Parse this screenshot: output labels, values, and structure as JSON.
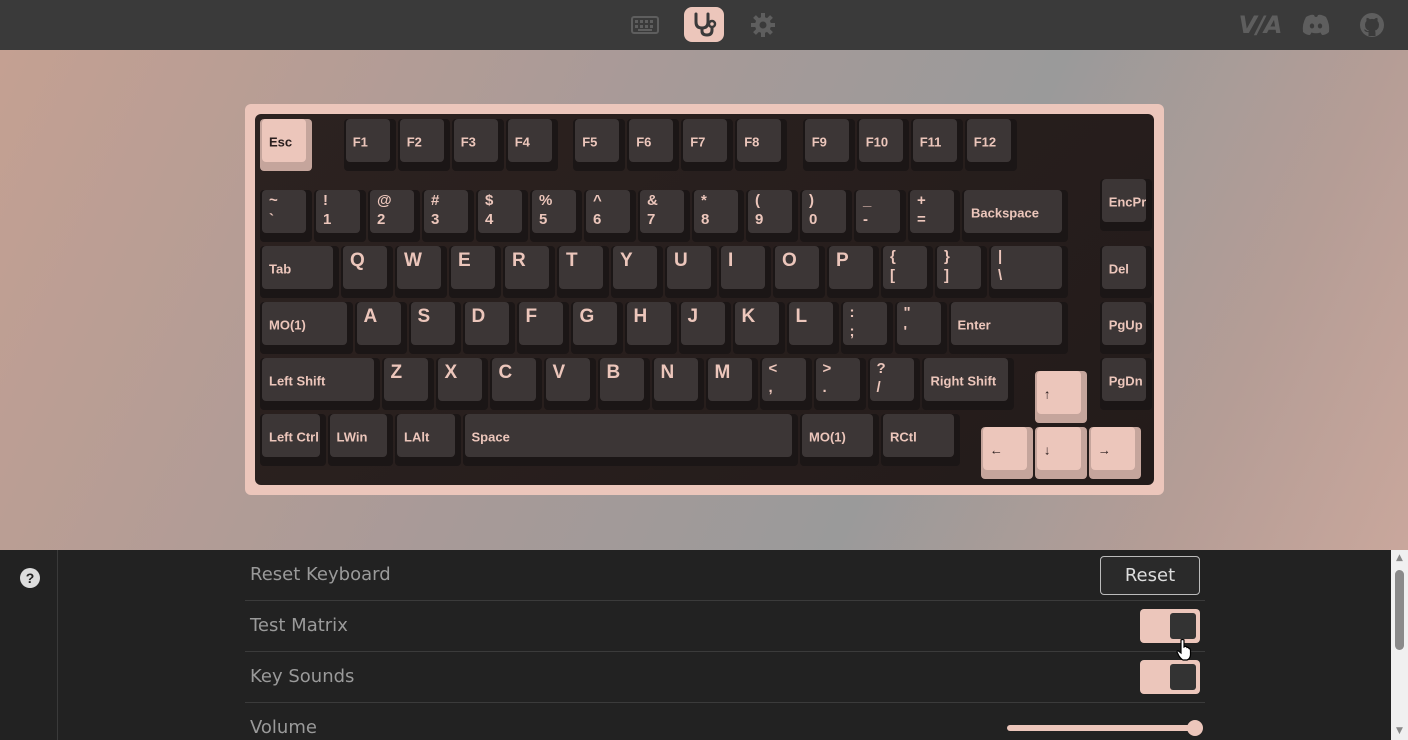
{
  "topnav": {
    "tabs": [
      {
        "name": "keyboard-tab",
        "icon": "keyboard-icon",
        "active": false
      },
      {
        "name": "debug-tab",
        "icon": "stethoscope-icon",
        "active": true
      },
      {
        "name": "settings-tab",
        "icon": "gear-icon",
        "active": false
      }
    ],
    "via_logo": "V/A",
    "links": [
      "discord-icon",
      "github-icon"
    ]
  },
  "colors": {
    "accent": "#ecc6bb",
    "topbar": "#3a3a3a",
    "keycap": "#3c3636",
    "board": "#2a2120",
    "pane": "#222222",
    "label": "#9a9a9a"
  },
  "keyboard": {
    "pressed_keys": [
      "Esc",
      "up",
      "left",
      "down",
      "right"
    ],
    "keys": [
      {
        "type": "label",
        "text": "Esc",
        "pink": true
      },
      {
        "type": "label",
        "text": "F1"
      },
      {
        "type": "label",
        "text": "F2"
      },
      {
        "type": "label",
        "text": "F3"
      },
      {
        "type": "label",
        "text": "F4"
      },
      {
        "type": "label",
        "text": "F5"
      },
      {
        "type": "label",
        "text": "F6"
      },
      {
        "type": "label",
        "text": "F7"
      },
      {
        "type": "label",
        "text": "F8"
      },
      {
        "type": "label",
        "text": "F9"
      },
      {
        "type": "label",
        "text": "F10"
      },
      {
        "type": "label",
        "text": "F11"
      },
      {
        "type": "label",
        "text": "F12"
      },
      {
        "type": "dual",
        "top": "~",
        "bot": "`"
      },
      {
        "type": "dual",
        "top": "!",
        "bot": "1"
      },
      {
        "type": "dual",
        "top": "@",
        "bot": "2"
      },
      {
        "type": "dual",
        "top": "#",
        "bot": "3"
      },
      {
        "type": "dual",
        "top": "$",
        "bot": "4"
      },
      {
        "type": "dual",
        "top": "%",
        "bot": "5"
      },
      {
        "type": "dual",
        "top": "^",
        "bot": "6"
      },
      {
        "type": "dual",
        "top": "&",
        "bot": "7"
      },
      {
        "type": "dual",
        "top": "*",
        "bot": "8"
      },
      {
        "type": "dual",
        "top": "(",
        "bot": "9"
      },
      {
        "type": "dual",
        "top": ")",
        "bot": "0"
      },
      {
        "type": "dual",
        "top": "_",
        "bot": "-"
      },
      {
        "type": "dual",
        "top": "+",
        "bot": "="
      },
      {
        "type": "label",
        "text": "Backspace"
      },
      {
        "type": "label",
        "text": "EncPrs"
      },
      {
        "type": "label",
        "text": "Tab"
      },
      {
        "type": "letter",
        "text": "Q"
      },
      {
        "type": "letter",
        "text": "W"
      },
      {
        "type": "letter",
        "text": "E"
      },
      {
        "type": "letter",
        "text": "R"
      },
      {
        "type": "letter",
        "text": "T"
      },
      {
        "type": "letter",
        "text": "Y"
      },
      {
        "type": "letter",
        "text": "U"
      },
      {
        "type": "letter",
        "text": "I"
      },
      {
        "type": "letter",
        "text": "O"
      },
      {
        "type": "letter",
        "text": "P"
      },
      {
        "type": "dual",
        "top": "{",
        "bot": "["
      },
      {
        "type": "dual",
        "top": "}",
        "bot": "]"
      },
      {
        "type": "dual",
        "top": "|",
        "bot": "\\"
      },
      {
        "type": "label",
        "text": "Del"
      },
      {
        "type": "label",
        "text": "MO(1)"
      },
      {
        "type": "letter",
        "text": "A"
      },
      {
        "type": "letter",
        "text": "S"
      },
      {
        "type": "letter",
        "text": "D"
      },
      {
        "type": "letter",
        "text": "F"
      },
      {
        "type": "letter",
        "text": "G"
      },
      {
        "type": "letter",
        "text": "H"
      },
      {
        "type": "letter",
        "text": "J"
      },
      {
        "type": "letter",
        "text": "K"
      },
      {
        "type": "letter",
        "text": "L"
      },
      {
        "type": "dual",
        "top": ":",
        "bot": ";"
      },
      {
        "type": "dual",
        "top": "\"",
        "bot": "'"
      },
      {
        "type": "label",
        "text": "Enter"
      },
      {
        "type": "label",
        "text": "PgUp"
      },
      {
        "type": "label",
        "text": "Left Shift"
      },
      {
        "type": "letter",
        "text": "Z"
      },
      {
        "type": "letter",
        "text": "X"
      },
      {
        "type": "letter",
        "text": "C"
      },
      {
        "type": "letter",
        "text": "V"
      },
      {
        "type": "letter",
        "text": "B"
      },
      {
        "type": "letter",
        "text": "N"
      },
      {
        "type": "letter",
        "text": "M"
      },
      {
        "type": "dual",
        "top": "<",
        "bot": ","
      },
      {
        "type": "dual",
        "top": ">",
        "bot": "."
      },
      {
        "type": "dual",
        "top": "?",
        "bot": "/"
      },
      {
        "type": "label",
        "text": "Right Shift"
      },
      {
        "type": "label",
        "text": "↑",
        "pink": true
      },
      {
        "type": "label",
        "text": "PgDn"
      },
      {
        "type": "label",
        "text": "Left Ctrl"
      },
      {
        "type": "label",
        "text": "LWin"
      },
      {
        "type": "label",
        "text": "LAlt"
      },
      {
        "type": "label",
        "text": "Space"
      },
      {
        "type": "label",
        "text": "MO(1)"
      },
      {
        "type": "label",
        "text": "RCtl"
      },
      {
        "type": "label",
        "text": "←",
        "pink": true
      },
      {
        "type": "label",
        "text": "↓",
        "pink": true
      },
      {
        "type": "label",
        "text": "→",
        "pink": true
      }
    ]
  },
  "settings": {
    "reset_label": "Reset Keyboard",
    "reset_button": "Reset",
    "test_matrix_label": "Test Matrix",
    "test_matrix_on": true,
    "key_sounds_label": "Key Sounds",
    "key_sounds_on": true,
    "volume_label": "Volume",
    "volume_value": 1.0
  }
}
